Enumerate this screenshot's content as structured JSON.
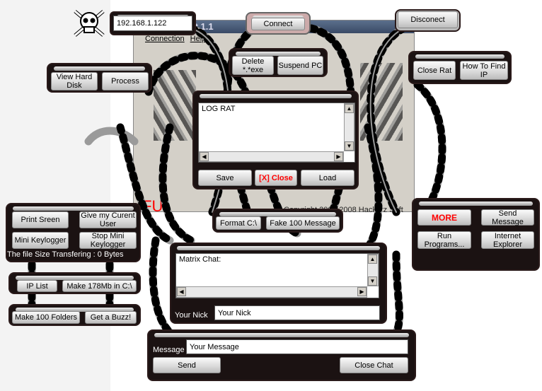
{
  "app": {
    "title": "Rat 1.1",
    "menu": [
      "Connection",
      "Help"
    ],
    "ful_text": "FUL",
    "copyright": "Copyright 2007-2008 Hackerz Soft",
    "logo": "skull-crossbones-icon"
  },
  "connection": {
    "ip_value": "192.168.1.122",
    "connect": "Connect",
    "disconnect": "Disconect"
  },
  "top": {
    "delete": "Delete *.*exe",
    "suspend": "Suspend PC",
    "view_disk": "View Hard Disk",
    "process": "Process",
    "close_rat": "Close Rat",
    "how_to_find_ip": "How To Find IP"
  },
  "log": {
    "text": "LOG RAT",
    "save": "Save",
    "close": "[X] Close",
    "load": "Load"
  },
  "format": {
    "format_c": "Format C:\\",
    "fake_message": "Fake 100 Message"
  },
  "left": {
    "print_screen": "Print Sreen",
    "current_user": "Give my Curent User",
    "mini_keylogger": "Mini Keylogger",
    "stop_keylogger": "Stop Mini Keylogger",
    "transfer_status": "The file Size Transfering : 0 Bytes",
    "ip_list": "IP List",
    "make_178": "Make 178Mb in C:\\",
    "make_folders": "Make 100 Folders",
    "buzz": "Get a Buzz!"
  },
  "right": {
    "more": "MORE",
    "send_message": "Send Message",
    "run_programs": "Run Programs...",
    "internet_explorer": "Internet Explorer"
  },
  "chat": {
    "text": "Matrix Chat:",
    "nick_label": "Your Nick",
    "nick_value": "Your Nick",
    "message_label": "Message",
    "message_value": "Your Message",
    "send": "Send",
    "close_chat": "Close Chat"
  },
  "colors": {
    "panel": "#1b1212",
    "window": "#d4d0c8",
    "alert_red": "#ff0000"
  }
}
